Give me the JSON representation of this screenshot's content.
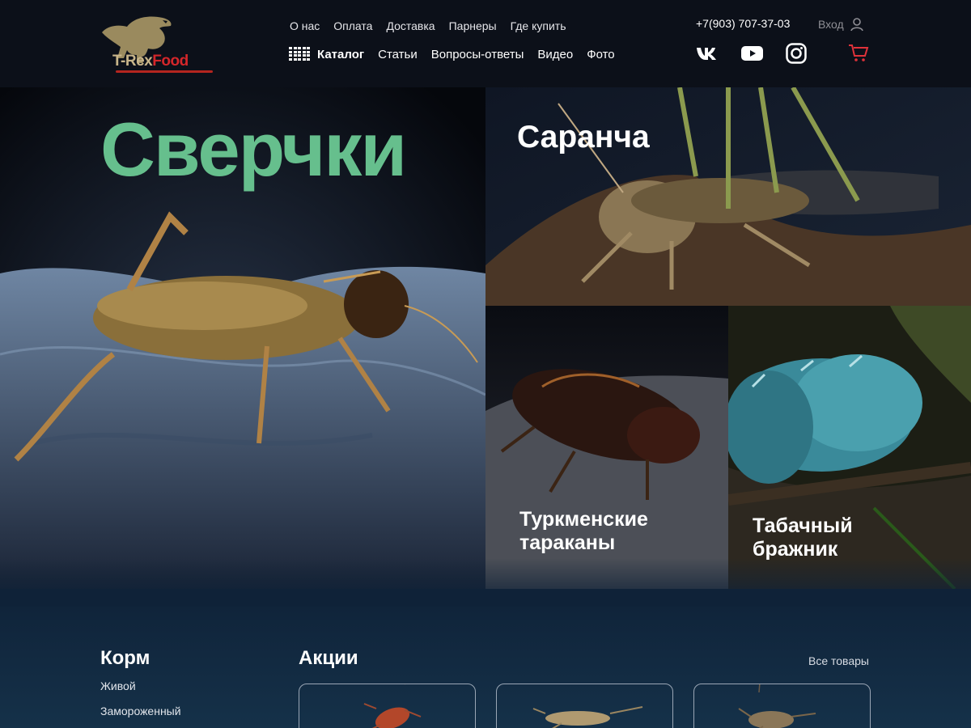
{
  "header": {
    "logo_alt": "T-Rex Food",
    "logo_word1": "T-Rex",
    "logo_word2": "Food",
    "top_nav": [
      "О нас",
      "Оплата",
      "Доставка",
      "Парнеры",
      "Где купить"
    ],
    "catalog_label": "Каталог",
    "main_nav": [
      "Статьи",
      "Вопросы-ответы",
      "Видео",
      "Фото"
    ],
    "phone": "+7(903) 707-37-03",
    "login_label": "Вход",
    "social_icons": [
      "vk-icon",
      "youtube-icon",
      "instagram-icon"
    ],
    "cart_icon": "cart-icon"
  },
  "hero": {
    "tiles": [
      {
        "title": "Сверчки",
        "color": "#66bf8d"
      },
      {
        "title": "Саранча",
        "color": "#ffffff"
      },
      {
        "title": "Туркменские тараканы",
        "color": "#ffffff"
      },
      {
        "title": "Табачный бражник",
        "color": "#ffffff"
      }
    ]
  },
  "korm": {
    "title": "Корм",
    "items": [
      "Живой",
      "Замороженный"
    ]
  },
  "akcii": {
    "title": "Акции",
    "all_link": "Все товары"
  },
  "colors": {
    "accent_green": "#66bf8d",
    "brand_red": "#d4262a",
    "cart_red": "#e0323a",
    "bottom_bg": "#0f2238"
  }
}
